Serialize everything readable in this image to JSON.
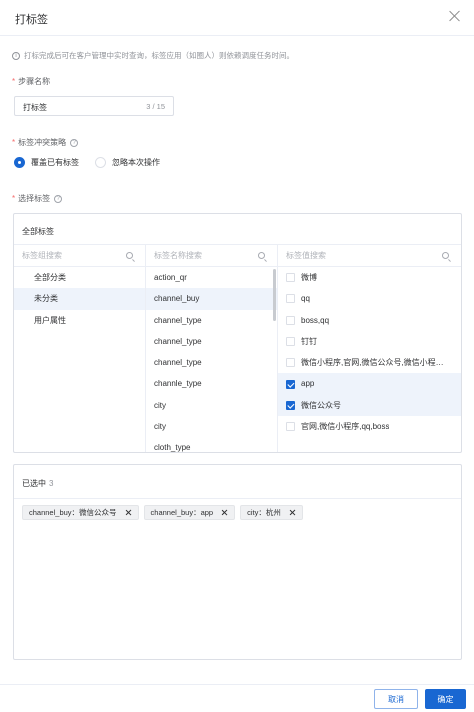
{
  "dialog": {
    "title": "打标签"
  },
  "tip": "打标完成后可在客户管理中实时查询，标签应用（如圈人）则依赖调度任务时间。",
  "step_name": {
    "label": "步骤名称",
    "value": "打标签",
    "counter": "3 / 15"
  },
  "conflict": {
    "label": "标签冲突策略",
    "options": [
      {
        "label": "覆盖已有标签",
        "checked": true
      },
      {
        "label": "忽略本次操作",
        "checked": false
      }
    ]
  },
  "select_tags": {
    "label": "选择标签",
    "panel_title": "全部标签",
    "col1": {
      "placeholder": "标签组搜索",
      "items": [
        "全部分类",
        "未分类",
        "用户属性"
      ],
      "active_index": 1
    },
    "col2": {
      "placeholder": "标签名称搜索",
      "items": [
        "action_qr",
        "channel_buy",
        "channel_type",
        "channel_type",
        "channel_type",
        "channle_type",
        "city",
        "city",
        "cloth_type"
      ],
      "active_index": 1
    },
    "col3": {
      "placeholder": "标签值搜索",
      "items": [
        {
          "label": "微博",
          "checked": false
        },
        {
          "label": "qq",
          "checked": false
        },
        {
          "label": "boss,qq",
          "checked": false
        },
        {
          "label": "钉钉",
          "checked": false
        },
        {
          "label": "微信小程序,官网,微信公众号,微信小程…",
          "checked": false
        },
        {
          "label": "app",
          "checked": true
        },
        {
          "label": "微信公众号",
          "checked": true
        },
        {
          "label": "官网,微信小程序,qq,boss",
          "checked": false
        }
      ]
    }
  },
  "selected": {
    "label": "已选中",
    "count": "3",
    "chips": [
      "channel_buy：微信公众号",
      "channel_buy：app",
      "city：杭州"
    ]
  },
  "footer": {
    "cancel": "取消",
    "ok": "确定"
  },
  "colors": {
    "primary": "#1967d2",
    "required": "#f56c6c",
    "active_row": "#eef3fb"
  }
}
